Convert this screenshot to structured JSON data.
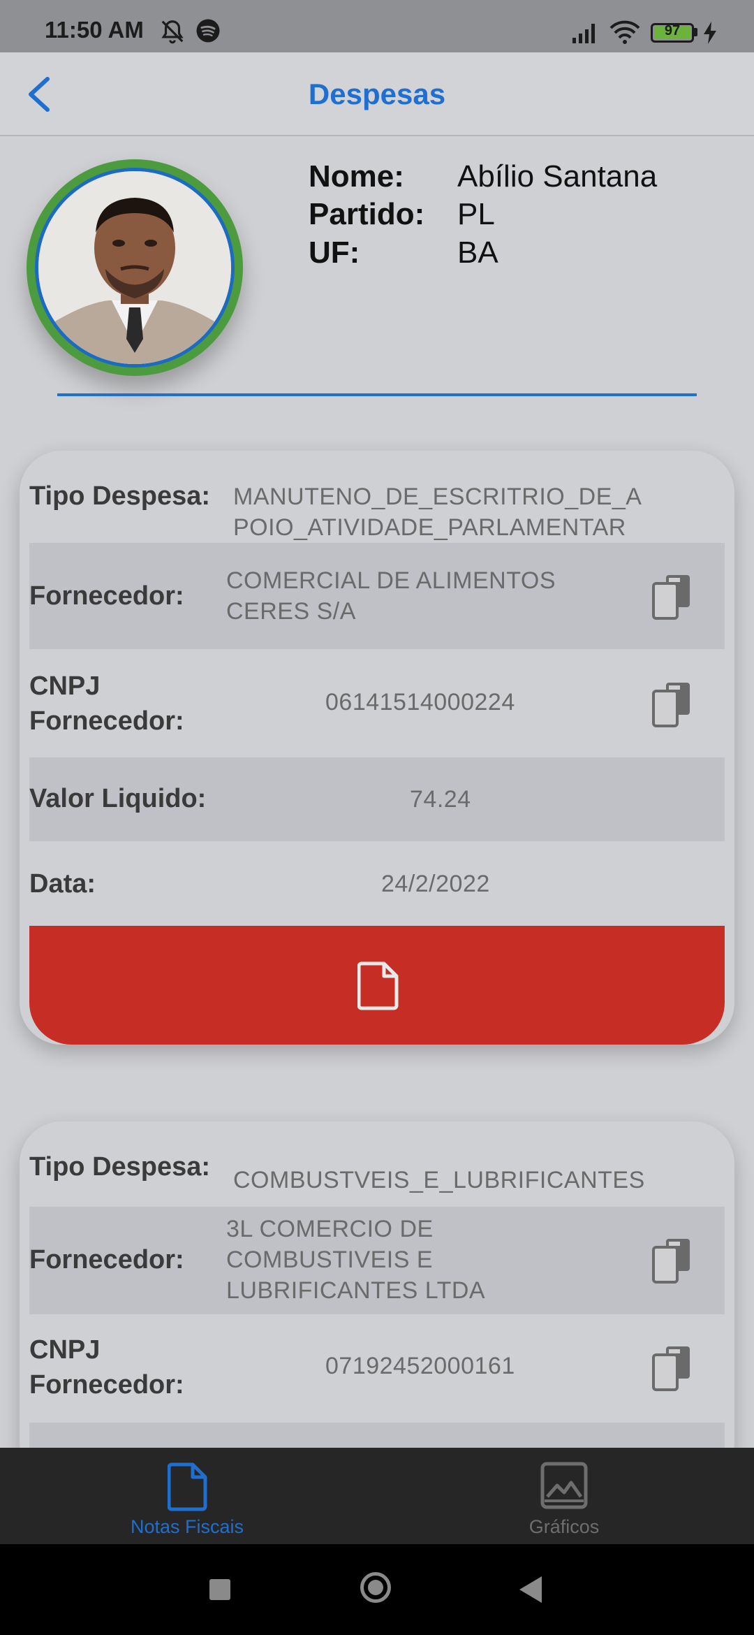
{
  "status_bar": {
    "time": "11:50 AM",
    "battery": "97"
  },
  "header": {
    "title": "Despesas"
  },
  "profile": {
    "name_label": "Nome:",
    "name": "Abílio Santana",
    "party_label": "Partido:",
    "party": "PL",
    "uf_label": "UF:",
    "uf": "BA"
  },
  "expenses": [
    {
      "tipo_label": "Tipo Despesa:",
      "tipo": "MANUTENO_DE_ESCRITRIO_DE_A\nPOIO_ATIVIDADE_PARLAMENTAR",
      "fornecedor_label": "Fornecedor:",
      "fornecedor": "COMERCIAL DE ALIMENTOS\nCERES S/A",
      "cnpj_label": "CNPJ\nFornecedor:",
      "cnpj": "06141514000224",
      "valor_label": "Valor Liquido:",
      "valor": "74.24",
      "data_label": "Data:",
      "data": "24/2/2022"
    },
    {
      "tipo_label": "Tipo Despesa:",
      "tipo": "COMBUSTVEIS_E_LUBRIFICANTES",
      "fornecedor_label": "Fornecedor:",
      "fornecedor": "3L COMERCIO DE\nCOMBUSTIVEIS E\nLUBRIFICANTES LTDA",
      "cnpj_label": "CNPJ\nFornecedor:",
      "cnpj": "07192452000161"
    }
  ],
  "bottom_nav": {
    "tabs": [
      {
        "label": "Notas Fiscais",
        "icon": "document-icon",
        "active": true
      },
      {
        "label": "Gráficos",
        "icon": "chart-image-icon",
        "active": false
      }
    ]
  },
  "colors": {
    "accent": "#1f6fd0",
    "pdf_button": "#c62e25",
    "avatar_ring": "#4d9b3f",
    "nav_inactive": "#6e6e6e"
  }
}
